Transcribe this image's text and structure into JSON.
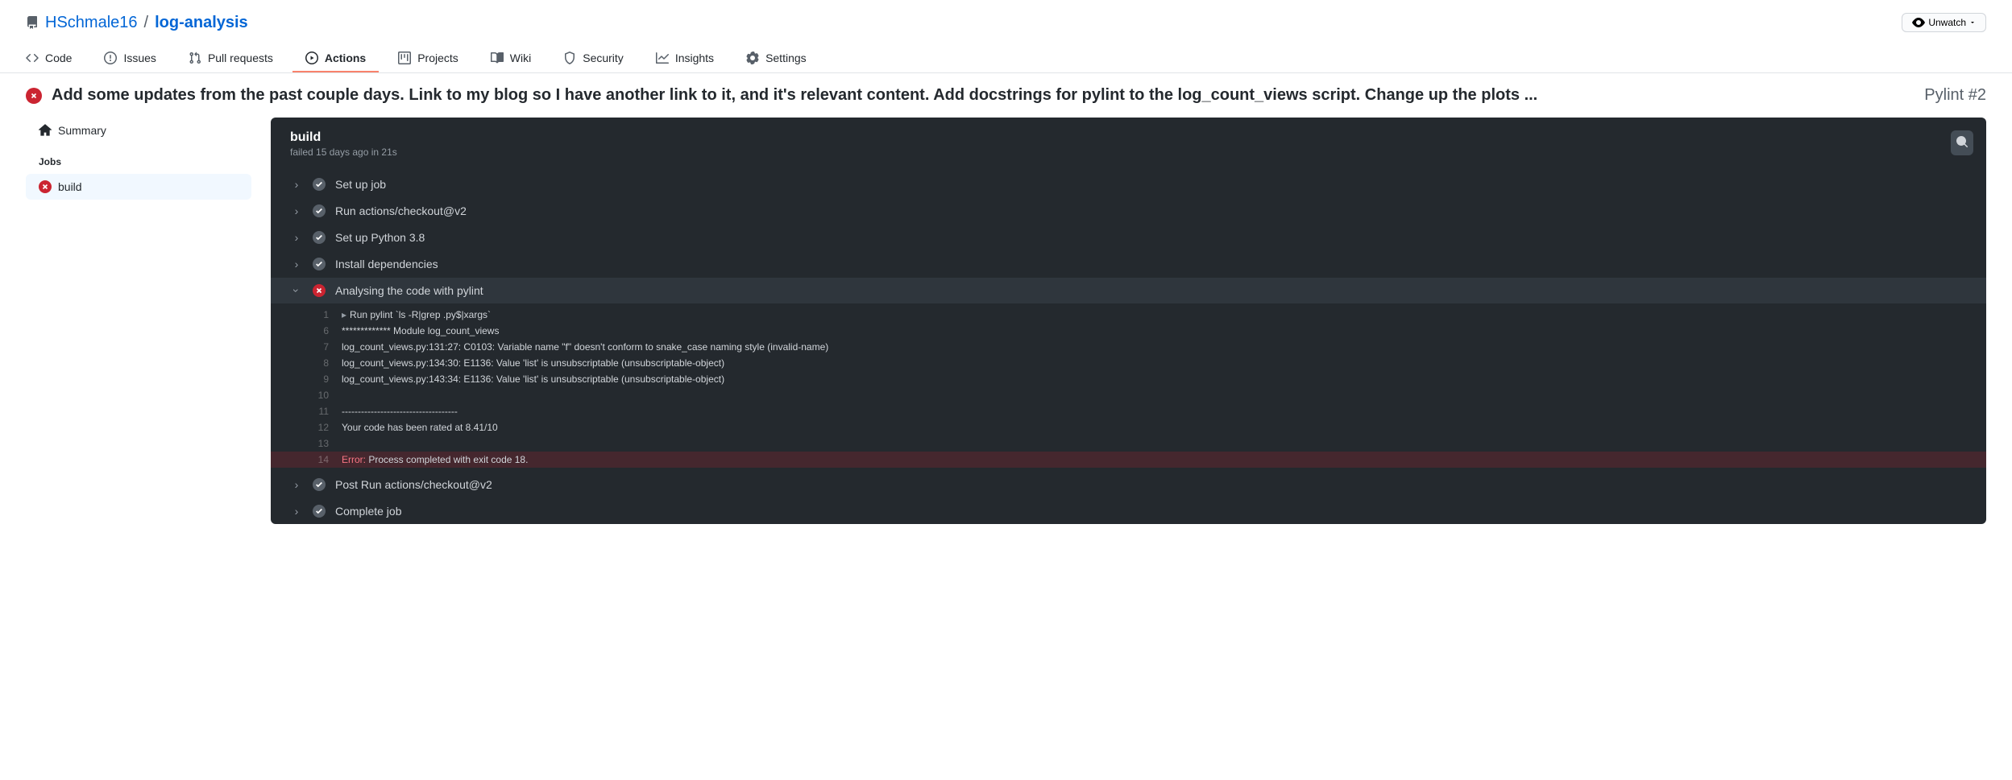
{
  "repo": {
    "owner": "HSchmale16",
    "name": "log-analysis",
    "unwatch": "Unwatch"
  },
  "tabs": {
    "code": "Code",
    "issues": "Issues",
    "pulls": "Pull requests",
    "actions": "Actions",
    "projects": "Projects",
    "wiki": "Wiki",
    "security": "Security",
    "insights": "Insights",
    "settings": "Settings"
  },
  "run": {
    "title": "Add some updates from the past couple days. Link to my blog so I have another link to it, and it's relevant content. Add docstrings for pylint to the log_count_views script. Change up the plots ...",
    "workflow": "Pylint #2"
  },
  "sidebar": {
    "summary": "Summary",
    "jobs_heading": "Jobs",
    "job": "build"
  },
  "job": {
    "name": "build",
    "meta": "failed 15 days ago in 21s"
  },
  "steps": {
    "setup": "Set up job",
    "checkout": "Run actions/checkout@v2",
    "python": "Set up Python 3.8",
    "deps": "Install dependencies",
    "analyse": "Analysing the code with pylint",
    "post_checkout": "Post Run actions/checkout@v2",
    "complete": "Complete job"
  },
  "log": {
    "l1": "Run pylint `ls -R|grep .py$|xargs`",
    "l6": "************* Module log_count_views",
    "l7": "log_count_views.py:131:27: C0103: Variable name \"f\" doesn't conform to snake_case naming style (invalid-name)",
    "l8": "log_count_views.py:134:30: E1136: Value 'list' is unsubscriptable (unsubscriptable-object)",
    "l9": "log_count_views.py:143:34: E1136: Value 'list' is unsubscriptable (unsubscriptable-object)",
    "l10": "",
    "l11": "------------------------------------",
    "l12": "Your code has been rated at 8.41/10",
    "l13": "",
    "l14_err": "Error:",
    "l14_rest": " Process completed with exit code 18."
  }
}
